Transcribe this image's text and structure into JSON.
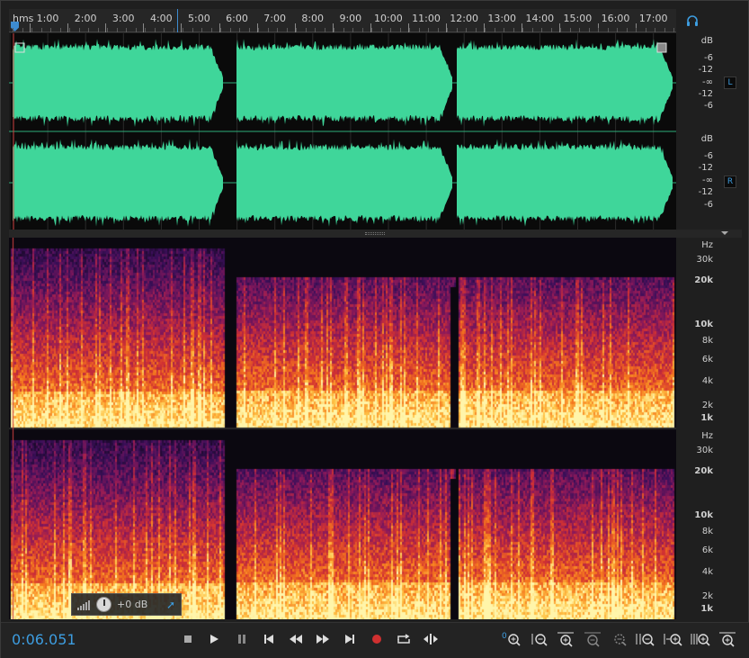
{
  "ruler": {
    "unit_label": "hms",
    "time_labels": [
      "1:00",
      "2:00",
      "3:00",
      "4:00",
      "5:00",
      "6:00",
      "7:00",
      "8:00",
      "9:00",
      "10:00",
      "11:00",
      "12:00",
      "13:00",
      "14:00",
      "15:00",
      "16:00",
      "17:00"
    ]
  },
  "waveform": {
    "channels": [
      {
        "badge": "L",
        "scale": [
          "dB",
          "-6",
          "-12",
          "-∞",
          "-12",
          "-6"
        ]
      },
      {
        "badge": "R",
        "scale": [
          "dB",
          "-6",
          "-12",
          "-∞",
          "-12",
          "-6"
        ]
      }
    ],
    "color": "#3fd69a"
  },
  "spectral": {
    "scale_labels": [
      "Hz",
      "30k",
      "20k",
      "10k",
      "8k",
      "6k",
      "4k",
      "2k",
      "1k"
    ]
  },
  "hud": {
    "gain_value": "+0 dB"
  },
  "transport": {
    "current_time": "0:06.051",
    "accent_color": "#3d9de0"
  }
}
